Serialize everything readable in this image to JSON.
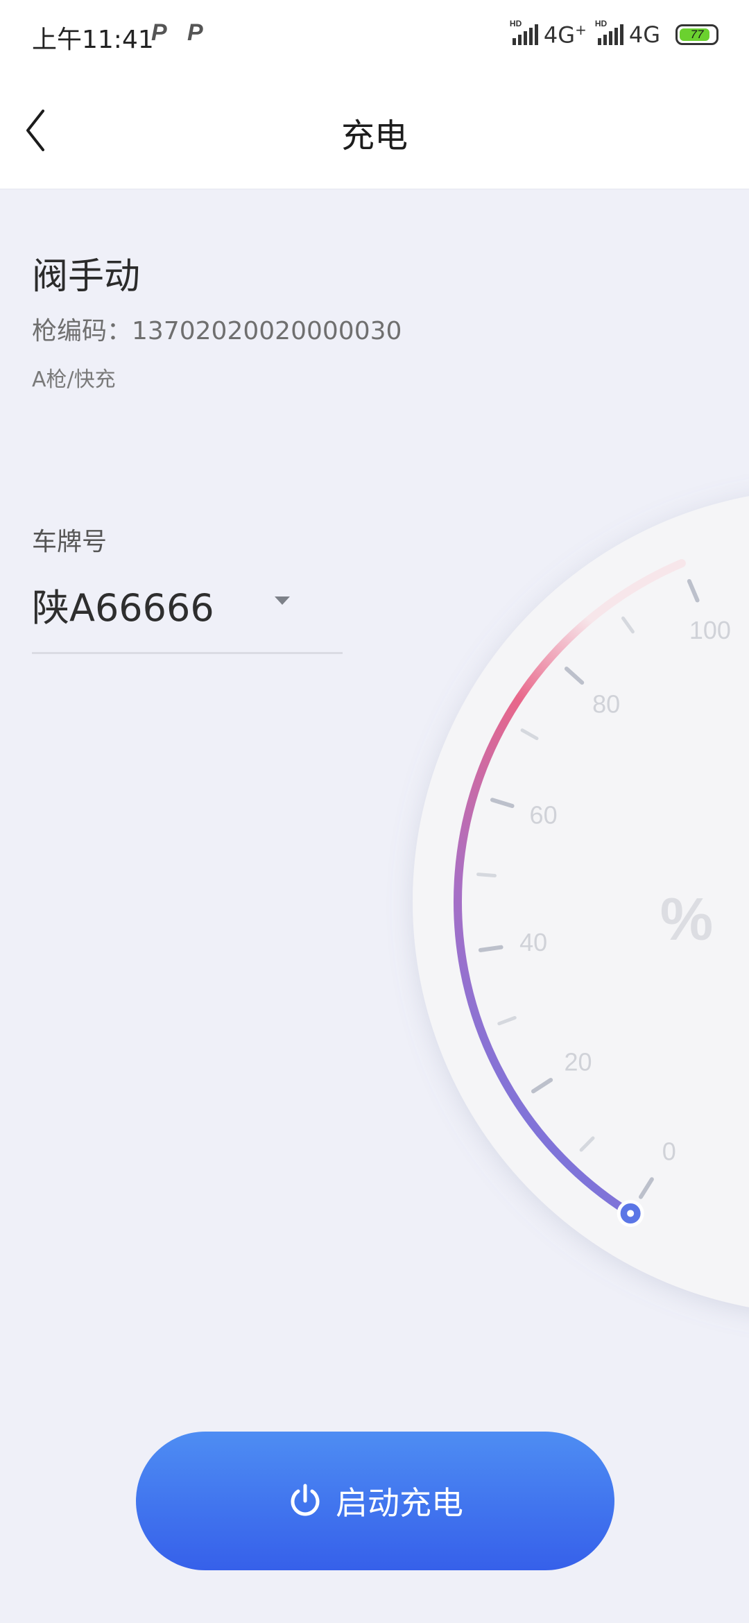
{
  "status_bar": {
    "time": "上午11:41",
    "network_1": "4G",
    "network_1_suffix": "+",
    "network_2": "4G",
    "hd": "HD",
    "battery": "77",
    "battery_color": "#6bd12f",
    "icons": [
      "p-notification-icon",
      "p-notification-icon",
      "signal-icon",
      "signal-icon",
      "battery-icon"
    ]
  },
  "header": {
    "title": "充电",
    "back_icon": "chevron-left-icon"
  },
  "station": {
    "name": "阀手动",
    "gun_code_label": "枪编码",
    "gun_code_value": "13702020020000030",
    "gun_type": "A枪/快充"
  },
  "plate": {
    "label": "车牌号",
    "value": "陕A66666",
    "dropdown_icon": "caret-down-icon"
  },
  "gauge": {
    "ticks": [
      "0",
      "20",
      "40",
      "60",
      "80",
      "100"
    ],
    "unit": "%",
    "level": 0,
    "gradient_colors": [
      "#5e77e8",
      "#a66fc6",
      "#e8678a",
      "#f7e6ea"
    ]
  },
  "start_button": {
    "label": "启动充电",
    "icon": "power-icon",
    "colors": [
      "#4e8df3",
      "#3660ea"
    ]
  }
}
